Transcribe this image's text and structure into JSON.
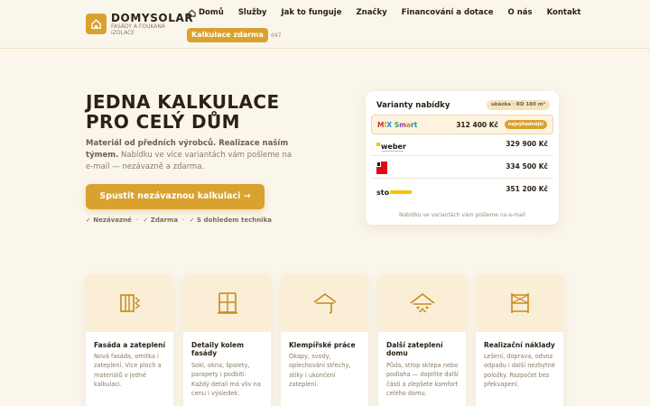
{
  "brand": {
    "name": "DOMYSOLAR",
    "tagline": "FASÁDY A FOUKANÁ IZOLACE"
  },
  "nav": {
    "items": [
      {
        "label": "Domů",
        "icon": "home-icon"
      },
      {
        "label": "Služby"
      },
      {
        "label": "Jak to funguje"
      },
      {
        "label": "Značky"
      },
      {
        "label": "Financování a dotace"
      },
      {
        "label": "O nás"
      },
      {
        "label": "Kontakt"
      }
    ],
    "cta": "Kalkulace zdarma",
    "extra": "d47"
  },
  "hero": {
    "title_line1": "JEDNA KALKULACE",
    "title_line2": "PRO CELÝ DŮM",
    "sub_bold": "Materiál od předních výrobců. Realizace naším týmem.",
    "sub_rest": "Nabídku ve více variantách vám pošleme na e-mail — nezávazně a zdarma.",
    "button": "Spustit nezávaznou kalkulaci →",
    "checks": [
      "✓ Nezávazné",
      "✓ Zdarma",
      "✓ S dohledem technika"
    ]
  },
  "offer": {
    "title": "Varianty nabídky",
    "badge": "ukázka · RD 180 m²",
    "rows": [
      {
        "brand": "MIX Smart",
        "price": "312 400 Kč",
        "badge": "nejvýhodnější"
      },
      {
        "brand": "weber",
        "price": "329 900 Kč"
      },
      {
        "brand": "baumit",
        "price": "334 500 Kč"
      },
      {
        "brand": "sto",
        "price": "351 200 Kč"
      }
    ],
    "footer": "Nabídku ve variantách vám pošleme na e-mail"
  },
  "services": [
    {
      "title": "Fasáda a zateplení",
      "desc": "Nová fasáda, omítka i zateplení. Více ploch a materiálů v jedné kalkulaci.",
      "icon": "facade-icon"
    },
    {
      "title": "Detaily kolem fasády",
      "desc": "Sokl, okna, špalety, parapety i podbití. Každý detail má vliv na cenu i výsledek.",
      "icon": "window-icon"
    },
    {
      "title": "Klempířské práce",
      "desc": "Okapy, svody, oplechování střechy, atiky i ukončení zateplení.",
      "icon": "gutter-icon"
    },
    {
      "title": "Další zateplení domu",
      "desc": "Půda, strop sklepa nebo podlaha — doplňte další části a zlepšete komfort celého domu.",
      "icon": "roof-insulation-icon"
    },
    {
      "title": "Realizační náklady",
      "desc": "Lešení, doprava, odvoz odpadu i další nezbytné položky. Rozpočet bez překvapení.",
      "icon": "scaffold-icon"
    }
  ],
  "colors": {
    "accent": "#d9a22e",
    "background": "#fbf6ec",
    "text": "#2b2116"
  }
}
